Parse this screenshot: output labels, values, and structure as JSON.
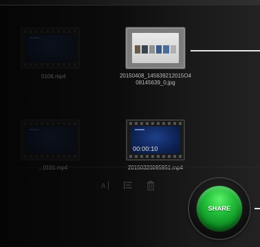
{
  "files": [
    {
      "name_line1": "",
      "name_line2": "0106.mp4",
      "kind": "video",
      "dimmed": true
    },
    {
      "name_line1": "20150408_145639212015O4",
      "name_line2": "08145639_0.jpg",
      "kind": "photo",
      "dimmed": false
    },
    {
      "name_line1": "",
      "name_line2": "...0101.mp4",
      "kind": "video",
      "dimmed": true
    },
    {
      "name_line1": "20150320095951.mp4",
      "name_line2": "",
      "kind": "video",
      "dimmed": false,
      "duration": "00:00:10"
    }
  ],
  "toolbar": {
    "rename_icon": "rename-icon",
    "sort_icon": "sort-icon",
    "delete_icon": "trash-icon"
  },
  "share": {
    "label": "SHARE",
    "color": "#22c03a"
  },
  "colors": {
    "background": "#0c0c0c",
    "pointer": "#e8e8e8"
  }
}
